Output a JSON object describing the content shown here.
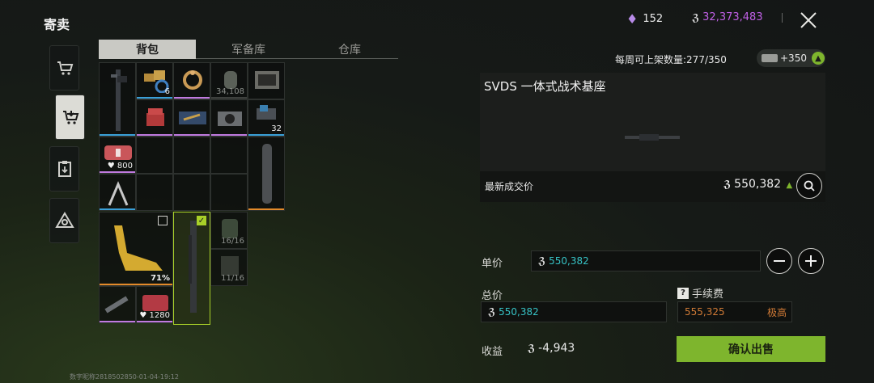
{
  "window": {
    "title": "寄卖"
  },
  "sidebar": {
    "items": [
      {
        "name": "cart"
      },
      {
        "name": "sell"
      },
      {
        "name": "orders"
      },
      {
        "name": "triangle"
      }
    ]
  },
  "tabs": [
    {
      "label": "背包",
      "active": true
    },
    {
      "label": "军备库",
      "active": false
    },
    {
      "label": "仓库",
      "active": false
    }
  ],
  "inventory": {
    "counts": {
      "c0": "6",
      "c1": "34,108",
      "c2": "32",
      "c3": "800",
      "c4": "71%",
      "c5": "16/16",
      "c6": "11/16",
      "c7": "1280"
    }
  },
  "currency": {
    "gems": "152",
    "coins": "32,373,483",
    "coin_symbol": "ℨ"
  },
  "listing": {
    "weekly_label": "每周可上架数量:277/350",
    "badge": "+350",
    "item_name": "SVDS 一体式战术基座",
    "last_price_label": "最新成交价",
    "last_price_value": "550,382"
  },
  "form": {
    "unit_price_label": "单价",
    "unit_price_value": "550,382",
    "total_label": "总价",
    "total_value": "550,382",
    "fee_label": "手续费",
    "fee_value": "555,325",
    "fee_level": "极高",
    "profit_label": "收益",
    "profit_value": "-4,943",
    "confirm_label": "确认出售"
  },
  "footer": {
    "text": "数字昵称2818502850-01-04-19:12"
  },
  "colors": {
    "accent_green": "#7eb52d",
    "value_cyan": "#36c2c5",
    "coin_purple": "#c060e6",
    "fee_orange": "#d07a36"
  }
}
